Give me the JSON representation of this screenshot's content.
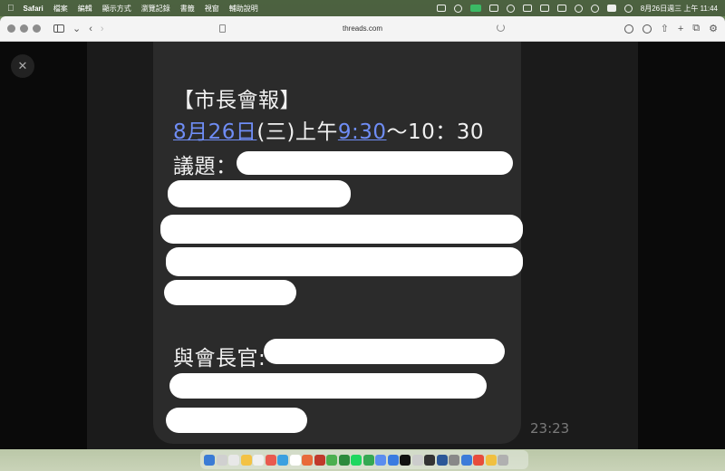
{
  "menubar": {
    "app_name": "Safari",
    "menus": [
      "檔案",
      "編輯",
      "顯示方式",
      "瀏覽記錄",
      "書籤",
      "視窗",
      "輔助說明"
    ],
    "clock": "8月26日週三 上午 11:44"
  },
  "browser": {
    "url": "threads.com"
  },
  "post": {
    "line1": "【市長會報】",
    "date_link": "8月26日",
    "weekday": "(三)上午",
    "time_link": "9:30",
    "time_end": "～10：30",
    "agenda_label": "議題：",
    "attendees_label": "與會長官:",
    "timestamp": "23:23"
  },
  "colors": {
    "link": "#6f8df5",
    "bubble": "#2b2b2b",
    "panel": "#1b1b1b",
    "redaction": "#ffffff"
  },
  "dock": {
    "icon_colors": [
      "#3a7bd5",
      "#d0d0d0",
      "#e8e8e8",
      "#f3c244",
      "#f0f0f0",
      "#e85a4f",
      "#3aa0e0",
      "#ffffff",
      "#e86a3a",
      "#c0392b",
      "#4caf50",
      "#2d8a3e",
      "#1ed760",
      "#34a853",
      "#5b8def",
      "#3a7be0",
      "#111111",
      "#cccccc",
      "#333333",
      "#2b5797",
      "#888888",
      "#3d7bd9",
      "#e74c3c",
      "#f0c040",
      "#b0b0b0"
    ]
  }
}
